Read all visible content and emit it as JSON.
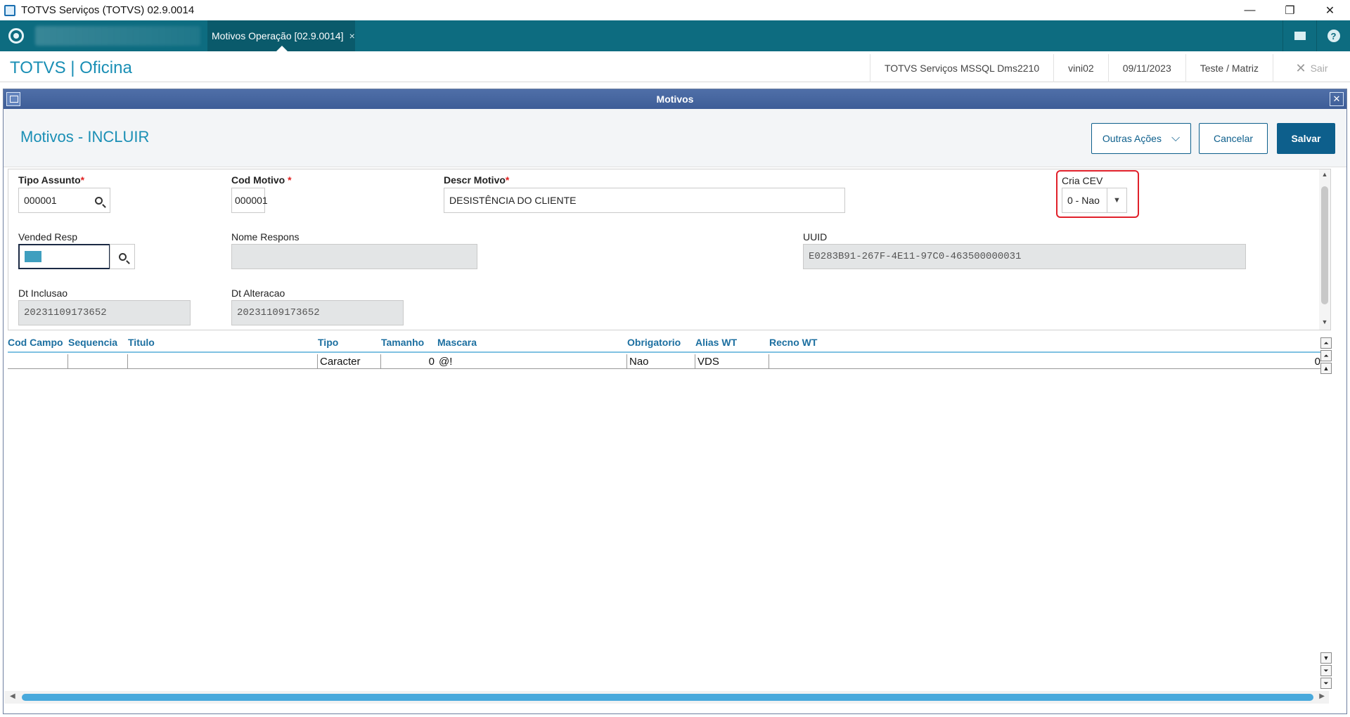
{
  "window": {
    "title": "TOTVS Serviços (TOTVS) 02.9.0014",
    "minimize": "—",
    "restore": "❐",
    "close": "✕"
  },
  "tabs": {
    "active_label": "Motivos Operação [02.9.0014]",
    "close_glyph": "×",
    "mail_label": "",
    "help_label": "?"
  },
  "header": {
    "brand": "TOTVS | Oficina",
    "server": "TOTVS Serviços MSSQL Dms2210",
    "user": "vini02",
    "date": "09/11/2023",
    "company": "Teste / Matriz",
    "exit_label": "Sair",
    "exit_glyph": "✕"
  },
  "modal": {
    "title": "Motivos",
    "close_glyph": "✕"
  },
  "page": {
    "title": "Motivos - INCLUIR",
    "btn_outras": "Outras Ações",
    "btn_outras_chevron": "⌵",
    "btn_cancel": "Cancelar",
    "btn_save": "Salvar"
  },
  "form": {
    "tipo_assunto": {
      "label": "Tipo Assunto",
      "req": "*",
      "value": "000001"
    },
    "cod_motivo": {
      "label": "Cod Motivo",
      "req": " *",
      "value": "000001"
    },
    "descr_motivo": {
      "label": "Descr Motivo",
      "req": "*",
      "value": "DESISTÊNCIA DO CLIENTE"
    },
    "cria_cev": {
      "label": "Cria CEV",
      "value": "0 - Nao",
      "arrow": "▼"
    },
    "vended_resp": {
      "label": "Vended Resp",
      "value": ""
    },
    "nome_respons": {
      "label": "Nome Respons",
      "value": ""
    },
    "uuid": {
      "label": "UUID",
      "value": "E0283B91-267F-4E11-97C0-463500000031"
    },
    "dt_inclusao": {
      "label": "Dt Inclusao",
      "value": "20231109173652"
    },
    "dt_alteracao": {
      "label": "Dt Alteracao",
      "value": "20231109173652"
    }
  },
  "grid": {
    "columns": [
      "Cod Campo",
      "Sequencia",
      "Titulo",
      "Tipo",
      "Tamanho",
      "Mascara",
      "Obrigatorio",
      "Alias WT",
      "Recno WT"
    ],
    "rows": [
      {
        "cod_campo": "",
        "sequencia": "",
        "titulo": "",
        "tipo": "Caracter",
        "tamanho": "0",
        "mascara": "@!",
        "obrigatorio": "Nao",
        "alias_wt": "VDS",
        "recno_wt": "0"
      }
    ]
  },
  "scroll": {
    "up": "▲",
    "down": "▼",
    "left": "◀",
    "right": "▶",
    "top": "⏶",
    "bottom": "⏷"
  }
}
